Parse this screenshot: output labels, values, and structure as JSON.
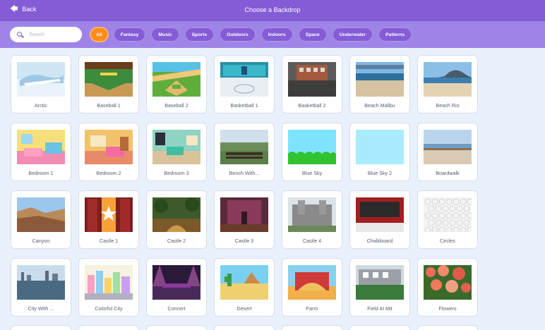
{
  "header": {
    "back_label": "Back",
    "title": "Choose a Backdrop"
  },
  "search": {
    "placeholder": "Search"
  },
  "filters": [
    "All",
    "Fantasy",
    "Music",
    "Sports",
    "Outdoors",
    "Indoors",
    "Space",
    "Underwater",
    "Patterns"
  ],
  "colors": {
    "header": "#855cd6",
    "filter_bar": "#9f84e8",
    "active_filter": "#ff8c1a",
    "background": "#e9f1fc"
  },
  "backdrops": [
    {
      "label": "Arctic",
      "thumb": "arctic"
    },
    {
      "label": "Baseball 1",
      "thumb": "baseball1"
    },
    {
      "label": "Baseball 2",
      "thumb": "baseball2"
    },
    {
      "label": "Basketball 1",
      "thumb": "basketball1"
    },
    {
      "label": "Basketball 2",
      "thumb": "basketball2"
    },
    {
      "label": "Beach Malibu",
      "thumb": "beach-malibu"
    },
    {
      "label": "Beach Rio",
      "thumb": "beach-rio"
    },
    {
      "label": "Bedroom 1",
      "thumb": "bedroom1"
    },
    {
      "label": "Bedroom 2",
      "thumb": "bedroom2"
    },
    {
      "label": "Bedroom 3",
      "thumb": "bedroom3"
    },
    {
      "label": "Bench With...",
      "thumb": "bench"
    },
    {
      "label": "Blue Sky",
      "thumb": "blue-sky"
    },
    {
      "label": "Blue Sky 2",
      "thumb": "blue-sky-2"
    },
    {
      "label": "Boardwalk",
      "thumb": "boardwalk"
    },
    {
      "label": "Canyon",
      "thumb": "canyon"
    },
    {
      "label": "Castle 1",
      "thumb": "castle1"
    },
    {
      "label": "Castle 2",
      "thumb": "castle2"
    },
    {
      "label": "Castle 3",
      "thumb": "castle3"
    },
    {
      "label": "Castle 4",
      "thumb": "castle4"
    },
    {
      "label": "Chalkboard",
      "thumb": "chalkboard"
    },
    {
      "label": "Circles",
      "thumb": "circles"
    },
    {
      "label": "City With ...",
      "thumb": "city"
    },
    {
      "label": "Colorful City",
      "thumb": "colorful-city"
    },
    {
      "label": "Concert",
      "thumb": "concert"
    },
    {
      "label": "Desert",
      "thumb": "desert"
    },
    {
      "label": "Farm",
      "thumb": "farm"
    },
    {
      "label": "Field At Mit",
      "thumb": "field-mit"
    },
    {
      "label": "Flowers",
      "thumb": "flowers"
    }
  ]
}
